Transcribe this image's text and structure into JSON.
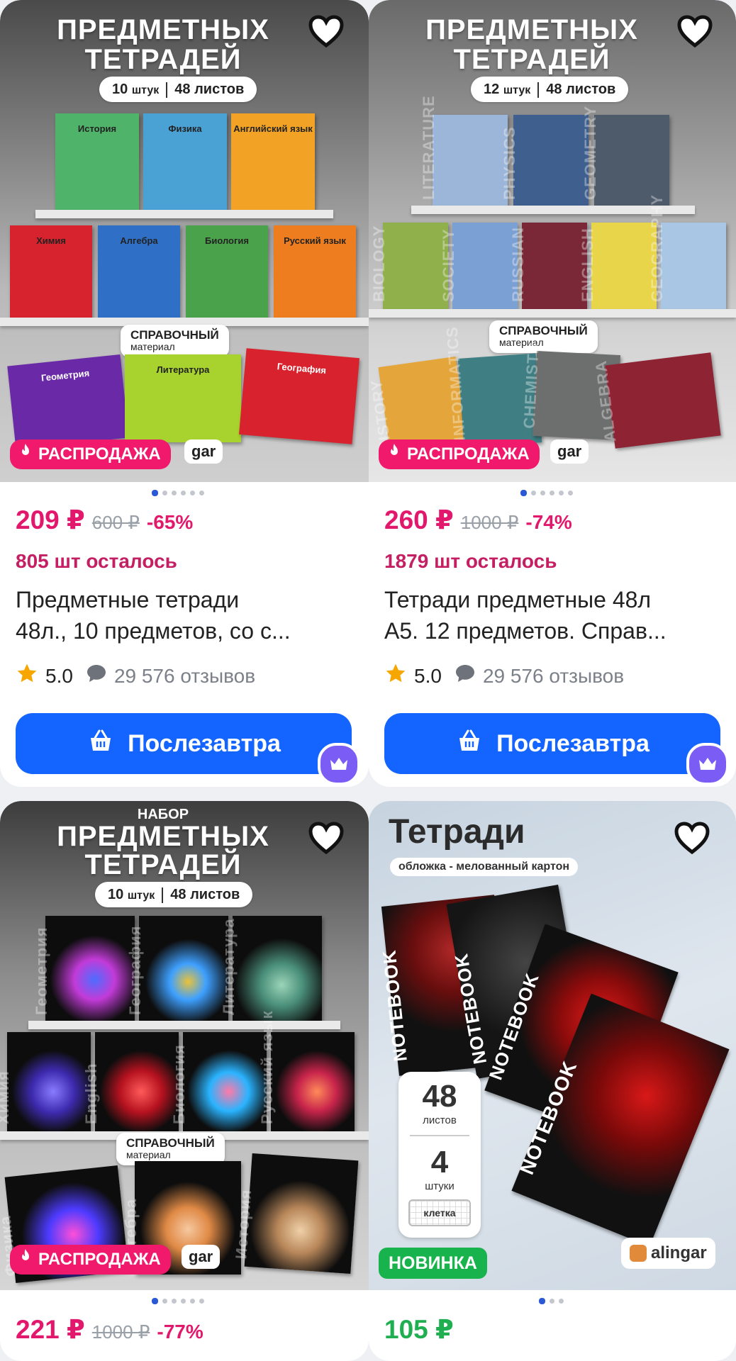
{
  "products": [
    {
      "image": {
        "heading_line1": "ПРЕДМЕТНЫХ",
        "heading_line2": "ТЕТРАДЕЙ",
        "pill_count": "10",
        "pill_count_unit": "штук",
        "pill_sheets": "48 листов",
        "notebooks_row1": [
          "История",
          "Физика",
          "Английский язык"
        ],
        "notebooks_row2": [
          "Химия",
          "Алгебра",
          "Биология",
          "Русский язык"
        ],
        "notebooks_row3": [
          "Геометрия",
          "Литература",
          "География"
        ],
        "ref_line1": "СПРАВОЧНЫЙ",
        "ref_line2": "материал",
        "badge": "РАСПРОДАЖА",
        "brand_fragment": "gar"
      },
      "price": "209 ₽",
      "old_price": "600 ₽",
      "discount": "-65%",
      "stock": "805 шт осталось",
      "title_line1": "Предметные тетради",
      "title_line2": "48л., 10 предметов, со с...",
      "rating": "5.0",
      "reviews": "29 576 отзывов",
      "button": "Послезавтра"
    },
    {
      "image": {
        "heading_line1": "ПРЕДМЕТНЫХ",
        "heading_line2": "ТЕТРАДЕЙ",
        "pill_count": "12",
        "pill_count_unit": "штук",
        "pill_sheets": "48 листов",
        "notebooks_row1": [
          "LITERATURE",
          "PHYSICS",
          "GEOMETRY"
        ],
        "notebooks_row2": [
          "BIOLOGY",
          "SOCIETY",
          "RUSSIAN",
          "ENGLISH",
          "GEOGRAPHY"
        ],
        "notebooks_row3": [
          "HISTORY",
          "INFORMATICS",
          "CHEMISTRY",
          "ALGEBRA"
        ],
        "ref_line1": "СПРАВОЧНЫЙ",
        "ref_line2": "материал",
        "badge": "РАСПРОДАЖА",
        "brand_fragment": "gar"
      },
      "price": "260 ₽",
      "old_price": "1000 ₽",
      "discount": "-74%",
      "stock": "1879 шт осталось",
      "title_line1": "Тетради предметные 48л",
      "title_line2": "А5. 12 предметов. Справ...",
      "rating": "5.0",
      "reviews": "29 576 отзывов",
      "button": "Послезавтра"
    },
    {
      "image": {
        "heading_top": "НАБОР",
        "heading_line1": "ПРЕДМЕТНЫХ",
        "heading_line2": "ТЕТРАДЕЙ",
        "pill_count": "10",
        "pill_count_unit": "штук",
        "pill_sheets": "48 листов",
        "notebooks_row1": [
          "Геометрия",
          "География",
          "Литература"
        ],
        "notebooks_row2": [
          "Химия",
          "English",
          "Биология",
          "Русский язык"
        ],
        "notebooks_row3": [
          "Физика",
          "Алгебра",
          "История"
        ],
        "ref_line1": "СПРАВОЧНЫЙ",
        "ref_line2": "материал",
        "badge": "РАСПРОДАЖА",
        "brand_fragment": "gar"
      },
      "price": "221 ₽",
      "old_price": "1000 ₽",
      "discount": "-77%"
    },
    {
      "image": {
        "heading": "Тетради",
        "subheading": "обложка - мелованный картон",
        "notebook_text": "NOTEBOOK",
        "sheets_value": "48",
        "sheets_label": "листов",
        "pieces_value": "4",
        "pieces_label": "штуки",
        "grid_label": "клетка",
        "badge": "НОВИНКА",
        "brand": "alingar"
      },
      "price": "105 ₽"
    }
  ]
}
